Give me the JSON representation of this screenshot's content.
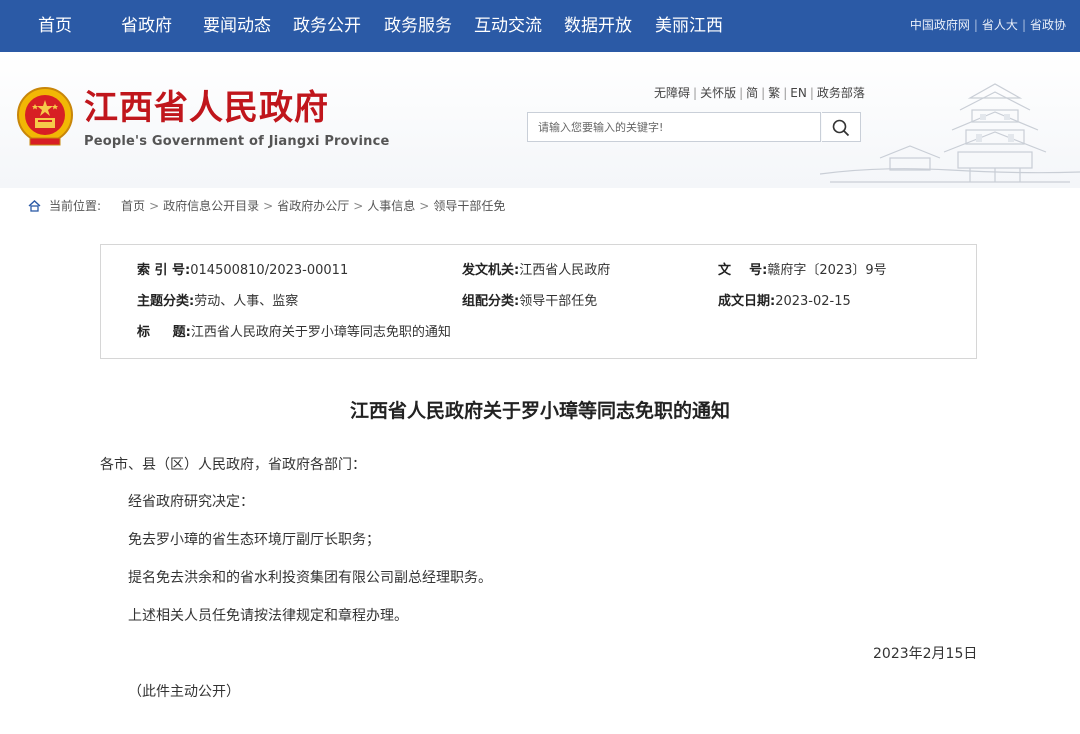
{
  "topnav": {
    "items": [
      "首页",
      "省政府",
      "要闻动态",
      "政务公开",
      "政务服务",
      "互动交流",
      "数据开放",
      "美丽江西"
    ],
    "right_links": [
      "中国政府网",
      "省人大",
      "省政协"
    ]
  },
  "header": {
    "title": "江西省人民政府",
    "subtitle": "People's Government of Jiangxi Province",
    "util_links": [
      "无障碍",
      "关怀版",
      "简",
      "繁",
      "EN",
      "政务部落"
    ],
    "search_placeholder": "请输入您要输入的关键字!"
  },
  "breadcrumb": {
    "label": "当前位置:",
    "items": [
      "首页",
      "政府信息公开目录",
      "省政府办公厅",
      "人事信息",
      "领导干部任免"
    ]
  },
  "info": {
    "index_key": "索 引 号:",
    "index_val": "014500810/2023-00011",
    "issuer_key": "发文机关:",
    "issuer_val": "江西省人民政府",
    "docno_key": "文    号:",
    "docno_val": "赣府字〔2023〕9号",
    "topic_key": "主题分类:",
    "topic_val": "劳动、人事、监察",
    "category_key": "组配分类:",
    "category_val": "领导干部任免",
    "date_key": "成文日期:",
    "date_val": "2023-02-15",
    "title_key": "标     题:",
    "title_val": "江西省人民政府关于罗小璋等同志免职的通知"
  },
  "article": {
    "title": "江西省人民政府关于罗小璋等同志免职的通知",
    "salutation": "各市、县（区）人民政府，省政府各部门：",
    "paragraphs": [
      "经省政府研究决定：",
      "免去罗小璋的省生态环境厅副厅长职务；",
      "提名免去洪余和的省水利投资集团有限公司副总经理职务。",
      "上述相关人员任免请按法律规定和章程办理。"
    ],
    "date": "2023年2月15日",
    "note": "（此件主动公开）"
  },
  "colors": {
    "nav_bg": "#2b5aa6",
    "title_red": "#c0161c"
  }
}
